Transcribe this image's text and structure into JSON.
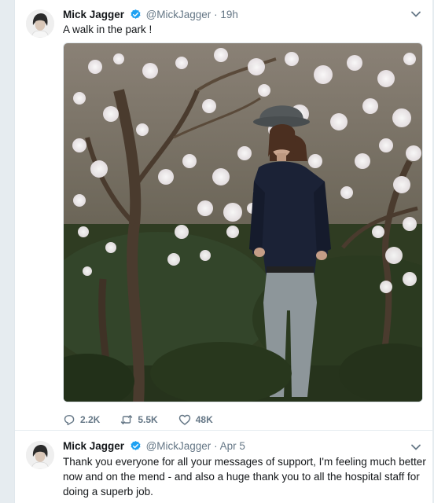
{
  "tweets": [
    {
      "name": "Mick Jagger",
      "handle": "@MickJagger",
      "separator": "·",
      "time": "19h",
      "text": "A walk in the park !",
      "replies": "2.2K",
      "retweets": "5.5K",
      "likes": "48K"
    },
    {
      "name": "Mick Jagger",
      "handle": "@MickJagger",
      "separator": "·",
      "time": "Apr 5",
      "text": "Thank you everyone for all your messages of support, I'm feeling much better now and on the mend - and also a huge thank you to all the hospital staff for doing a superb job."
    }
  ],
  "colors": {
    "accent": "#1da1f2",
    "muted": "#657786",
    "background": "#e6ecf0"
  },
  "icons": [
    "chevron-down-icon",
    "verified-badge-icon",
    "reply-icon",
    "retweet-icon",
    "like-icon"
  ]
}
